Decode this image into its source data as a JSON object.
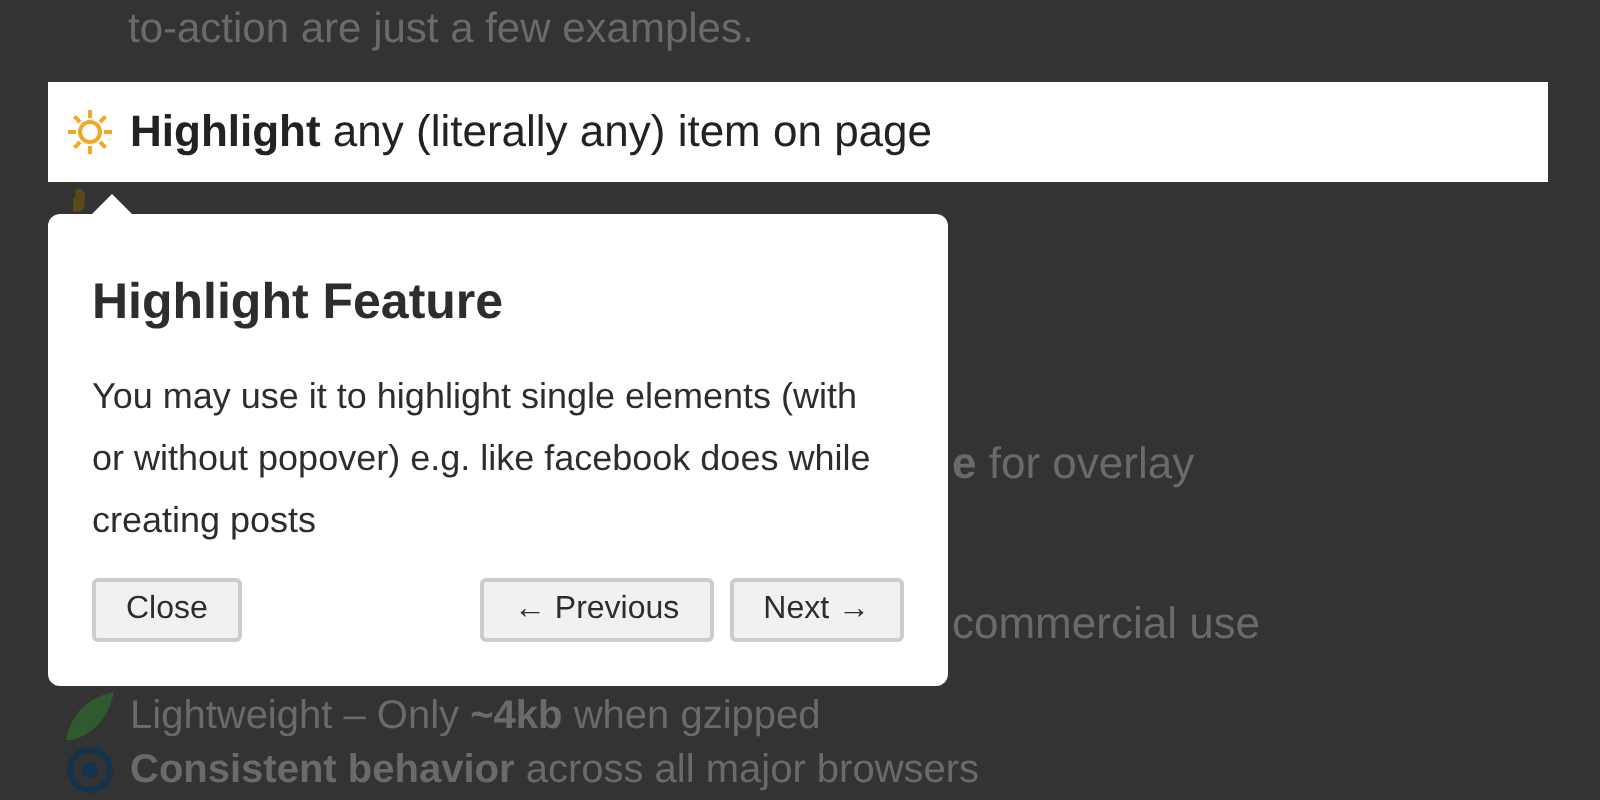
{
  "page": {
    "intro": "to-action are just a few examples.",
    "items": [
      {
        "kind": "highlight",
        "text": "**Highlight** any (literally any) item on page"
      },
      {
        "kind": "icon"
      },
      {
        "kind": "fragment",
        "text": "**e** for overlay"
      },
      {
        "kind": "fragment",
        "text": "commercial use"
      },
      {
        "kind": "item",
        "text": "Lightweight – Only **~4kb** when gzipped"
      },
      {
        "kind": "item",
        "text": "**Consistent behavior** across all major browsers"
      }
    ]
  },
  "popover": {
    "title": "Highlight Feature",
    "description": "You may use it to highlight single elements (with or without popover) e.g. like facebook does while creating posts",
    "buttons": [
      {
        "label": "Close",
        "kind": "close"
      },
      {
        "label": "← Previous",
        "kind": "previous"
      },
      {
        "label": "Next →",
        "kind": "next"
      }
    ]
  }
}
